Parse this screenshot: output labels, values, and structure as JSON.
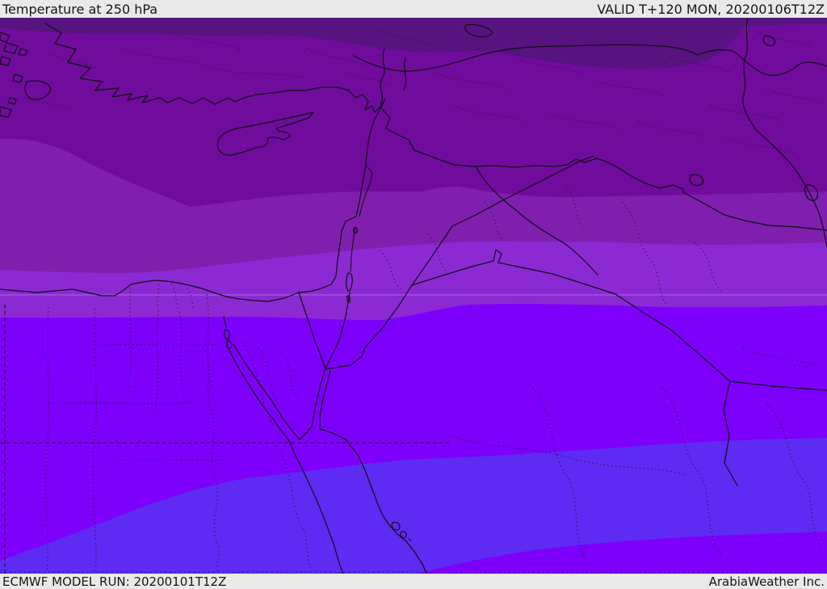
{
  "header": {
    "title": "Temperature at 250 hPa",
    "valid": "VALID T+120 MON, 20200106T12Z"
  },
  "footer": {
    "model_run": "ECMWF MODEL RUN: 20200101T12Z",
    "attribution": "ArabiaWeather Inc."
  },
  "map": {
    "kind": "temperature-filled-contour-map",
    "region": "Eastern Mediterranean / Middle East",
    "bands": [
      {
        "name": "band-1-coldest-top",
        "color": "#571380"
      },
      {
        "name": "band-2",
        "color": "#6f0c9c"
      },
      {
        "name": "band-3",
        "color": "#7f1fae"
      },
      {
        "name": "band-4",
        "color": "#8b2ad2"
      },
      {
        "name": "band-5",
        "color": "#7d00fa"
      },
      {
        "name": "band-6-blue",
        "color": "#5e2bf2"
      },
      {
        "name": "band-7-bottom-right",
        "color": "#7d00fa"
      }
    ],
    "lines": {
      "coast": "#0e0e12",
      "admin": "#2e0a3e",
      "dashed_border": "#21062e",
      "graticule": "#cfa3ef"
    },
    "bar_colors": {
      "background": "#e9e9e9",
      "text": "#161616"
    }
  }
}
